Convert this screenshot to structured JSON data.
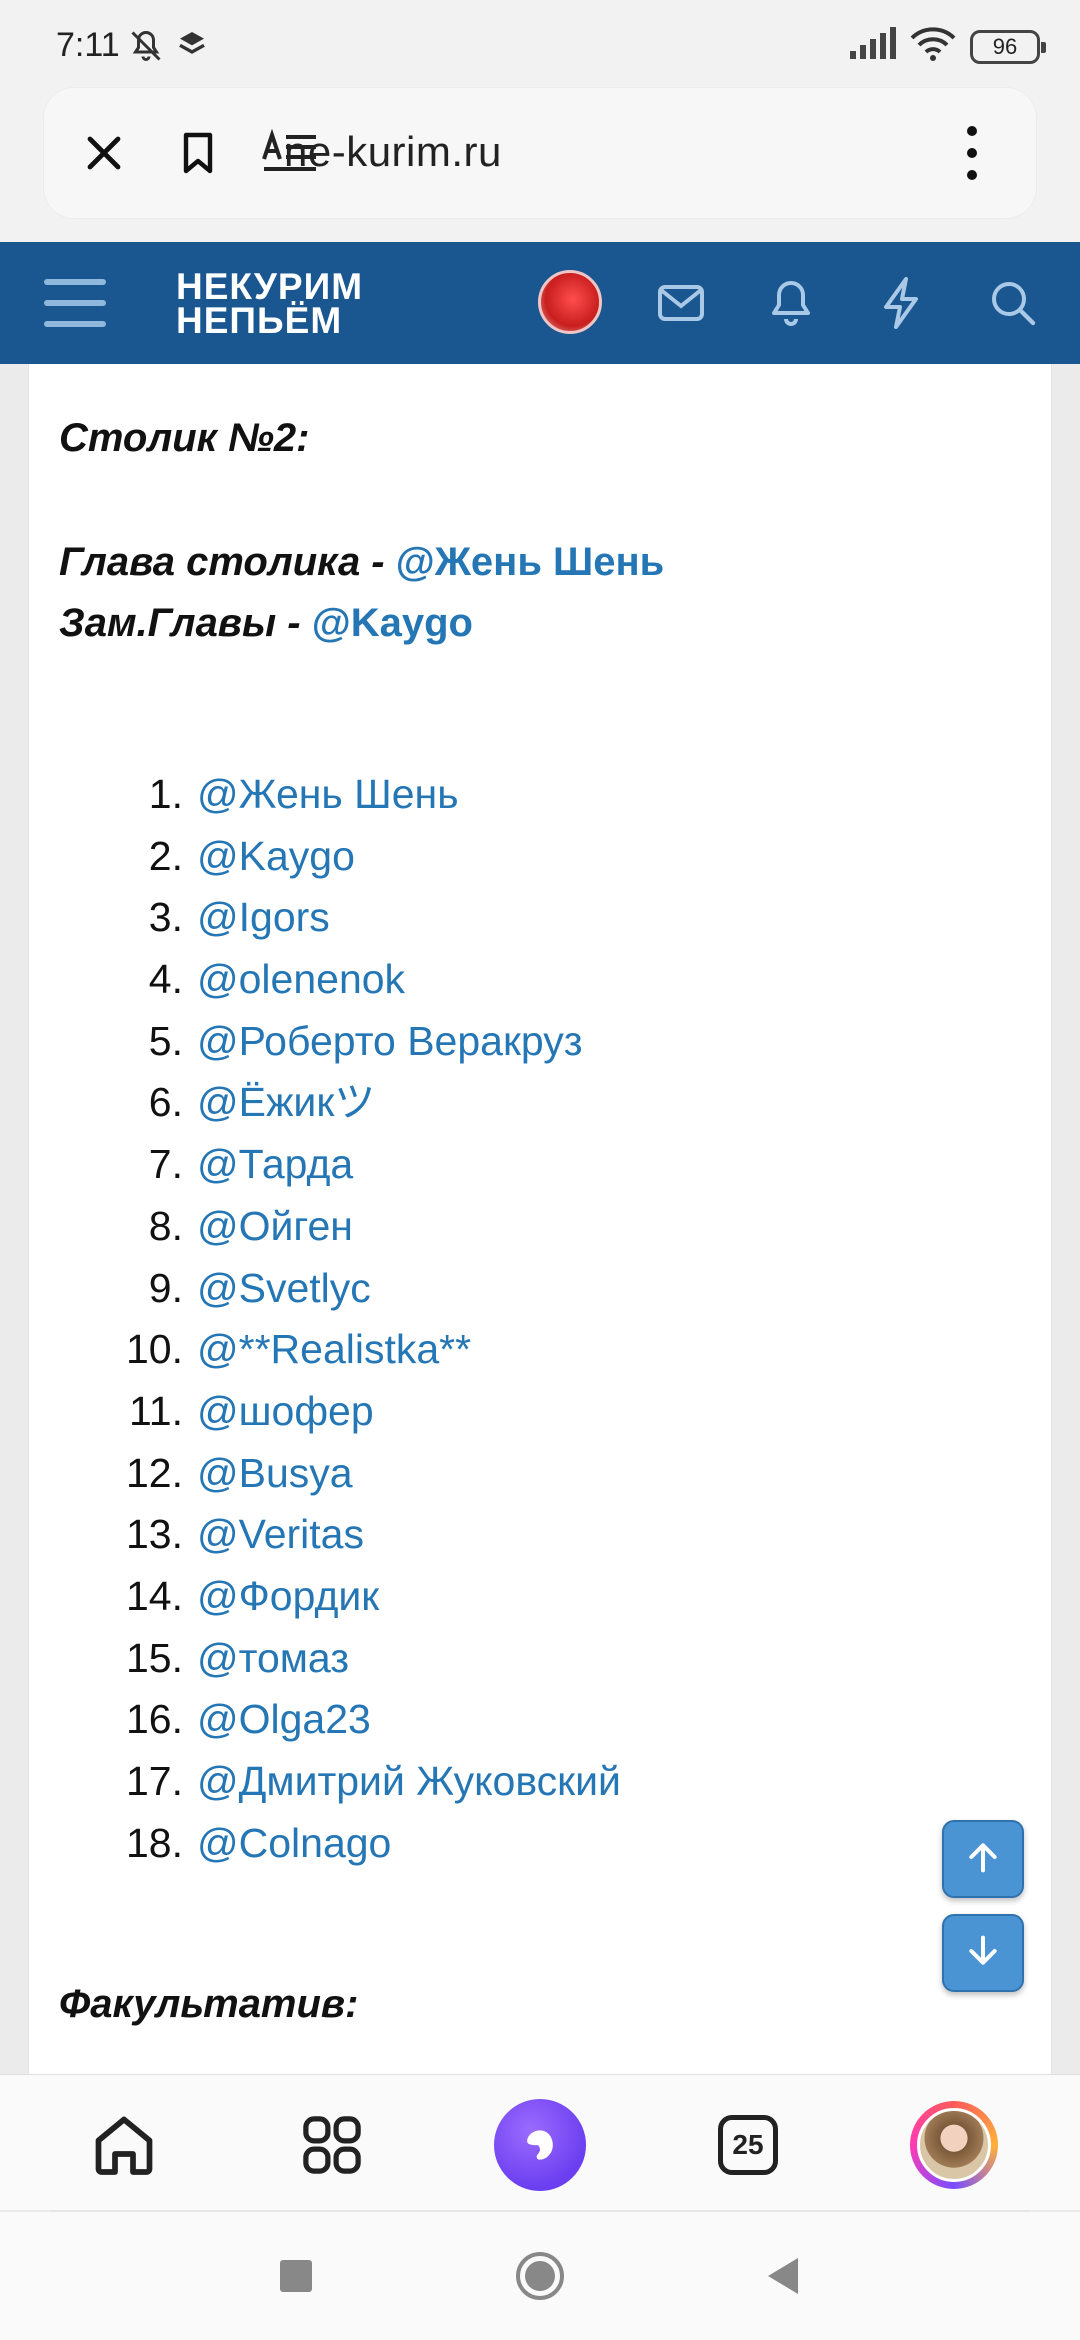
{
  "status_bar": {
    "time": "7:11",
    "battery": "96"
  },
  "browser": {
    "url": "ne-kurim.ru"
  },
  "site": {
    "logo_line1": "НЕКУРИМ",
    "logo_line2": "НЕПЬЁМ",
    "header_color": "#1a5791"
  },
  "post": {
    "table_title": "Столик №2:",
    "head_label": "Глава столика - ",
    "head_mention": "@Жень Шень",
    "deputy_label": "Зам.Главы - ",
    "deputy_mention": "@Kaygo",
    "members": [
      {
        "num": "1.",
        "name": "@Жень Шень"
      },
      {
        "num": "2.",
        "name": "@Kaygo"
      },
      {
        "num": "3.",
        "name": "@Igors"
      },
      {
        "num": "4.",
        "name": "@olenenok"
      },
      {
        "num": "5.",
        "name": "@Роберто Веракруз"
      },
      {
        "num": "6.",
        "name": "@Ёжикツ"
      },
      {
        "num": "7.",
        "name": "@Тарда"
      },
      {
        "num": "8.",
        "name": "@Ойген"
      },
      {
        "num": "9.",
        "name": "@Svetlyc"
      },
      {
        "num": "10.",
        "name": "@**Realistka**"
      },
      {
        "num": "11.",
        "name": "@шофер"
      },
      {
        "num": "12.",
        "name": "@Busya"
      },
      {
        "num": "13.",
        "name": "@Veritas"
      },
      {
        "num": "14.",
        "name": "@Фордик"
      },
      {
        "num": "15.",
        "name": "@томаз"
      },
      {
        "num": "16.",
        "name": "@Olga23"
      },
      {
        "num": "17.",
        "name": "@Дмитрий Жуковский"
      },
      {
        "num": "18.",
        "name": "@Colnago"
      }
    ],
    "elective_title": "Факультатив:",
    "mention_color": "#2576b5"
  },
  "bottom_nav": {
    "tabs_count": "25"
  },
  "icons": {
    "close": "close-icon",
    "bookmark": "bookmark-icon",
    "reader": "reader-mode-icon",
    "menu": "more-vertical-icon",
    "hamburger": "hamburger-menu-icon",
    "mail": "mail-icon",
    "bell": "bell-icon",
    "lightning": "lightning-icon",
    "search": "search-icon",
    "scroll_up": "arrow-up-icon",
    "scroll_down": "arrow-down-icon",
    "home": "home-icon",
    "apps": "apps-grid-icon",
    "alice": "alice-assistant-icon"
  }
}
